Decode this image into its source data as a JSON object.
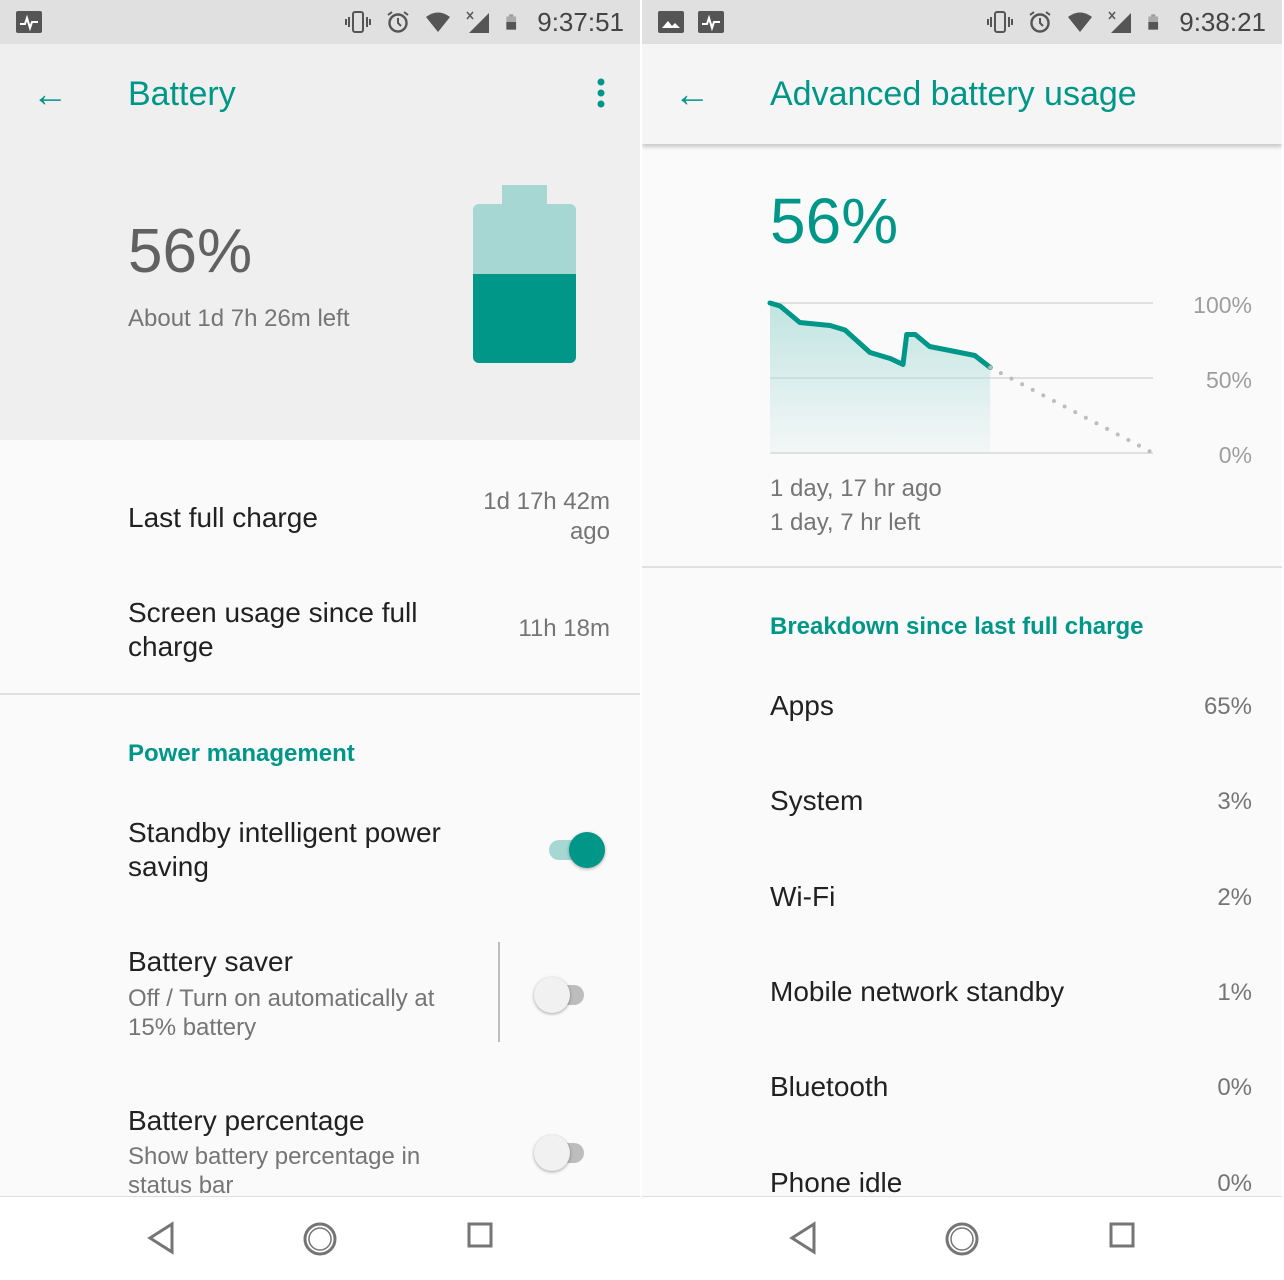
{
  "left": {
    "status": {
      "time": "9:37:51",
      "icons": [
        "activity-icon",
        "vibrate-icon",
        "alarm-icon",
        "wifi-icon",
        "signal-no-data-icon",
        "battery-icon"
      ]
    },
    "title": "Battery",
    "battery_percent": "56%",
    "battery_level": 56,
    "time_left": "About 1d 7h 26m left",
    "last_full_charge": {
      "label": "Last full charge",
      "value_line1": "1d 17h 42m",
      "value_line2": "ago"
    },
    "screen_usage": {
      "label_line1": "Screen usage since full",
      "label_line2": "charge",
      "value": "11h 18m"
    },
    "section": "Power management",
    "standby": {
      "label_line1": "Standby intelligent power",
      "label_line2": "saving",
      "on": true
    },
    "saver": {
      "label": "Battery saver",
      "sub_line1": "Off / Turn on automatically at",
      "sub_line2": "15% battery",
      "on": false
    },
    "percentage": {
      "label": "Battery percentage",
      "sub_line1": "Show battery percentage in",
      "sub_line2": "status bar",
      "on": false
    }
  },
  "right": {
    "status": {
      "time": "9:38:21",
      "icons": [
        "image-icon",
        "activity-icon",
        "vibrate-icon",
        "alarm-icon",
        "wifi-icon",
        "signal-no-data-icon",
        "battery-icon"
      ]
    },
    "title": "Advanced battery usage",
    "battery_percent": "56%",
    "since": "1 day, 17 hr ago",
    "left": "1 day, 7 hr left",
    "section": "Breakdown since last full charge",
    "items": [
      {
        "label": "Apps",
        "value": "65%"
      },
      {
        "label": "System",
        "value": "3%"
      },
      {
        "label": "Wi-Fi",
        "value": "2%"
      },
      {
        "label": "Mobile network standby",
        "value": "1%"
      },
      {
        "label": "Bluetooth",
        "value": "0%"
      },
      {
        "label": "Phone idle",
        "value": "0%"
      }
    ]
  },
  "chart_data": {
    "type": "line",
    "ytick_labels": [
      "100%",
      "50%",
      "0%"
    ],
    "ylim": [
      0,
      100
    ],
    "xlim": [
      0,
      72
    ],
    "grid": true,
    "series": [
      {
        "style": "solid-filled",
        "color": "#009688",
        "x": [
          0,
          1.9,
          5.6,
          11.3,
          14.1,
          18.8,
          22.6,
          25,
          25.7,
          27.3,
          30,
          35.7,
          38.5,
          41.4
        ],
        "values": [
          100,
          98,
          87,
          85,
          82,
          67,
          63,
          59,
          79,
          79,
          71,
          67,
          65,
          57
        ]
      },
      {
        "style": "dotted-projection",
        "color": "#bdbdbd",
        "x": [
          41.4,
          72
        ],
        "values": [
          57,
          0
        ]
      }
    ]
  },
  "colors": {
    "accent": "#009688",
    "accent_light": "#a7d7d2"
  },
  "nav": {
    "icons": [
      "back-triangle-icon",
      "home-circle-icon",
      "recents-square-icon"
    ]
  }
}
